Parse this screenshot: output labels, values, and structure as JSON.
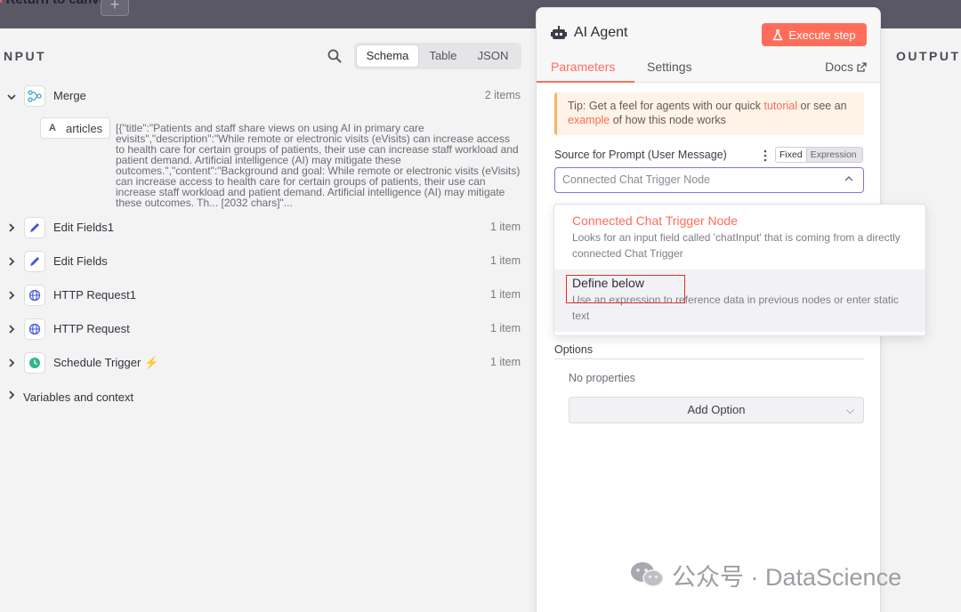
{
  "topbar": {
    "crumb": "Return to canvas",
    "add_symbol": "+"
  },
  "input": {
    "title": "NPUT",
    "view_tabs": [
      "Schema",
      "Table",
      "JSON"
    ],
    "nodes": [
      {
        "name": "Merge",
        "count": "2 items",
        "icon": "merge-icon"
      },
      {
        "name": "Edit Fields1",
        "count": "1 item",
        "icon": "pencil-icon"
      },
      {
        "name": "Edit Fields",
        "count": "1 item",
        "icon": "pencil-icon"
      },
      {
        "name": "HTTP Request1",
        "count": "1 item",
        "icon": "globe-icon"
      },
      {
        "name": "HTTP Request",
        "count": "1 item",
        "icon": "globe-icon"
      },
      {
        "name": "Schedule Trigger",
        "count": "1 item",
        "icon": "clock-icon"
      }
    ],
    "field": {
      "type_badge": "A",
      "name": "articles",
      "value": "[{\"title\":\"Patients and staff share views on using AI in primary care evisits\",\"description\":\"While remote or electronic visits (eVisits) can increase access to health care for certain groups of patients, their use can increase staff workload and patient demand. Artificial intelligence (AI) may mitigate these outcomes.\",\"content\":\"Background and goal: While remote or electronic visits (eVisits) can increase access to health care for certain groups of patients, their use can increase staff workload and patient demand. Artificial intelligence (AI) may mitigate these outcomes. Th... [2032 chars]\"..."
    },
    "variables_label": "Variables and context"
  },
  "node": {
    "title": "AI Agent",
    "execute_label": "Execute step",
    "tabs": [
      "Parameters",
      "Settings"
    ],
    "docs_label": "Docs",
    "tip": {
      "prefix": "Tip: Get a feel for agents with our quick ",
      "link1": "tutorial",
      "middle": " or see an ",
      "link2": "example",
      "suffix": " of how this node works"
    },
    "source_label": "Source for Prompt (User Message)",
    "toggle": [
      "Fixed",
      "Expression"
    ],
    "select_value": "Connected Chat Trigger Node",
    "options_label": "Options",
    "no_properties": "No properties",
    "add_option_label": "Add Option"
  },
  "dropdown": {
    "items": [
      {
        "title": "Connected Chat Trigger Node",
        "desc": "Looks for an input field called 'chatInput' that is coming from a directly connected Chat Trigger"
      },
      {
        "title": "Define below",
        "desc": "Use an expression to reference data in previous nodes or enter static text"
      }
    ]
  },
  "output": {
    "title": "OUTPUT"
  },
  "watermark": {
    "text": "公众号 · DataScience"
  },
  "colors": {
    "accent": "#ff6d5a",
    "focus": "#7b79d6",
    "highlight_box": "#e0302c"
  }
}
